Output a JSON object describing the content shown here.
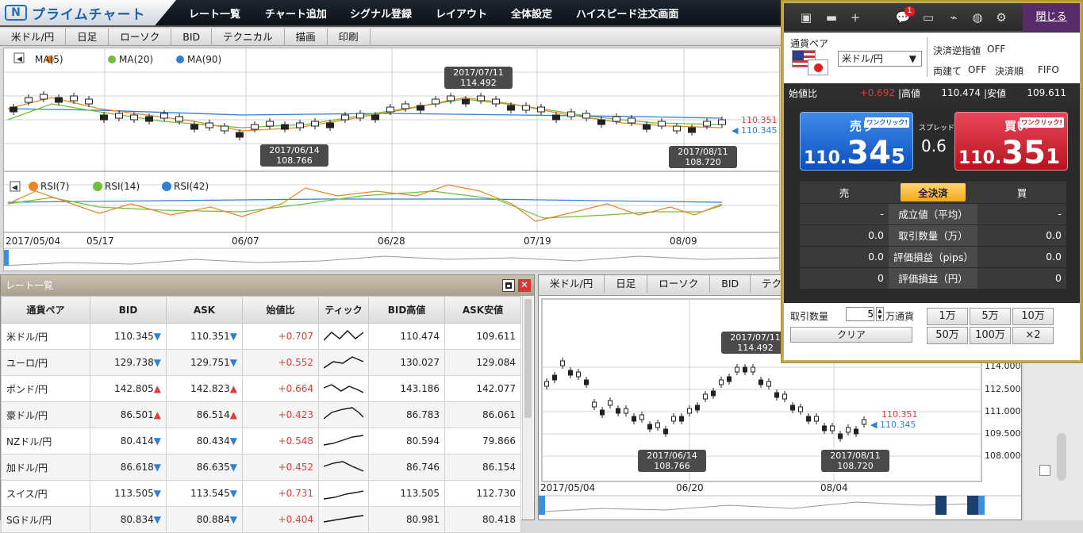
{
  "app": {
    "logo_mark": "N",
    "logo_text": "プライムチャート"
  },
  "menu": [
    "レート一覧",
    "チャート追加",
    "シグナル登録",
    "レイアウト",
    "全体設定",
    "ハイスピード注文画面"
  ],
  "chart1": {
    "tabs": [
      "米ドル/円",
      "日足",
      "ローソク",
      "BID",
      "テクニカル",
      "描画",
      "印刷"
    ],
    "ma_legend": [
      "MA(5)",
      "MA(20)",
      "MA(90)"
    ],
    "rsi_legend": [
      "RSI(7)",
      "RSI(14)",
      "RSI(42)"
    ],
    "callouts": [
      {
        "date": "2017/07/11",
        "value": "114.492"
      },
      {
        "date": "2017/06/14",
        "value": "108.766"
      },
      {
        "date": "2017/08/11",
        "value": "108.720"
      }
    ],
    "price_ask": "110.351",
    "price_bid": "110.345",
    "xlabels": [
      "2017/05/04",
      "05/17",
      "06/07",
      "06/28",
      "07/19",
      "08/09"
    ]
  },
  "rates": {
    "title": "レート一覧",
    "headers": [
      "通貨ペア",
      "BID",
      "ASK",
      "始値比",
      "ティック",
      "BID高値",
      "ASK安値"
    ],
    "rows": [
      {
        "pair": "米ドル/円",
        "bid": "110.345",
        "bid_dir": "down",
        "ask": "110.351",
        "ask_dir": "down",
        "change": "+0.707",
        "high": "110.474",
        "low": "109.611"
      },
      {
        "pair": "ユーロ/円",
        "bid": "129.738",
        "bid_dir": "down",
        "ask": "129.751",
        "ask_dir": "down",
        "change": "+0.552",
        "high": "130.027",
        "low": "129.084"
      },
      {
        "pair": "ポンド/円",
        "bid": "142.805",
        "bid_dir": "up",
        "ask": "142.823",
        "ask_dir": "up",
        "change": "+0.664",
        "high": "143.186",
        "low": "142.077"
      },
      {
        "pair": "豪ドル/円",
        "bid": "86.501",
        "bid_dir": "up",
        "ask": "86.514",
        "ask_dir": "up",
        "change": "+0.423",
        "high": "86.783",
        "low": "86.061"
      },
      {
        "pair": "NZドル/円",
        "bid": "80.414",
        "bid_dir": "down",
        "ask": "80.434",
        "ask_dir": "down",
        "change": "+0.548",
        "high": "80.594",
        "low": "79.866"
      },
      {
        "pair": "加ドル/円",
        "bid": "86.618",
        "bid_dir": "down",
        "ask": "86.635",
        "ask_dir": "down",
        "change": "+0.452",
        "high": "86.746",
        "low": "86.154"
      },
      {
        "pair": "スイス/円",
        "bid": "113.505",
        "bid_dir": "down",
        "ask": "113.545",
        "ask_dir": "down",
        "change": "+0.731",
        "high": "113.505",
        "low": "112.730"
      },
      {
        "pair": "SGドル/円",
        "bid": "80.834",
        "bid_dir": "down",
        "ask": "80.884",
        "ask_dir": "down",
        "change": "+0.404",
        "high": "80.981",
        "low": "80.418"
      }
    ]
  },
  "chart2": {
    "tabs": [
      "米ドル/円",
      "日足",
      "ローソク",
      "BID",
      "テクニカル"
    ],
    "yticks": [
      "114.000",
      "112.500",
      "111.000",
      "109.500",
      "108.000"
    ],
    "callouts": [
      {
        "date": "2017/07/11",
        "value": "114.492"
      },
      {
        "date": "2017/06/14",
        "value": "108.766"
      },
      {
        "date": "2017/08/11",
        "value": "108.720"
      }
    ],
    "price_ask": "110.351",
    "price_bid": "110.345",
    "xlabels": [
      "2017/05/04",
      "06/20",
      "08/04"
    ]
  },
  "order": {
    "close_label": "閉じる",
    "badge": "1",
    "pair_label": "通貨ペア",
    "pair_value": "米ドル/円",
    "stop_label": "決済逆指値",
    "stop_value": "OFF",
    "hedge_label": "両建て",
    "hedge_value": "OFF",
    "order_label": "決済順",
    "order_value": "FIFO",
    "open_change_label": "始値比",
    "open_change": "+0.692",
    "high_label": "高値",
    "high": "110.474",
    "low_label": "安値",
    "low": "109.611",
    "sell_label": "売り",
    "buy_label": "買い",
    "oneclick": "ワンクリック!",
    "sell_small": "110.",
    "sell_big": "34",
    "sell_last": "5",
    "buy_small": "110.",
    "buy_big": "35",
    "buy_last": "1",
    "spread_label": "スプレッド",
    "spread": "0.6",
    "pos_sell": "売",
    "pos_all": "全決済",
    "pos_buy": "買",
    "pos_rows": [
      {
        "label": "成立値（平均）",
        "sell": "-",
        "buy": "-"
      },
      {
        "label": "取引数量（万）",
        "sell": "0.0",
        "buy": "0.0"
      },
      {
        "label": "評価損益（pips）",
        "sell": "0.0",
        "buy": "0.0"
      },
      {
        "label": "評価損益（円）",
        "sell": "0",
        "buy": "0"
      }
    ],
    "qty_label": "取引数量",
    "qty_value": "5",
    "qty_unit": "万通貨",
    "clear_label": "クリア",
    "presets": [
      "1万",
      "5万",
      "10万",
      "50万",
      "100万",
      "×2"
    ]
  },
  "colors": {
    "up": "#e03a3a",
    "down": "#2d7fd7",
    "ma5": "#e8852a",
    "ma20": "#6fbf3b",
    "ma90": "#2f7fd6"
  }
}
